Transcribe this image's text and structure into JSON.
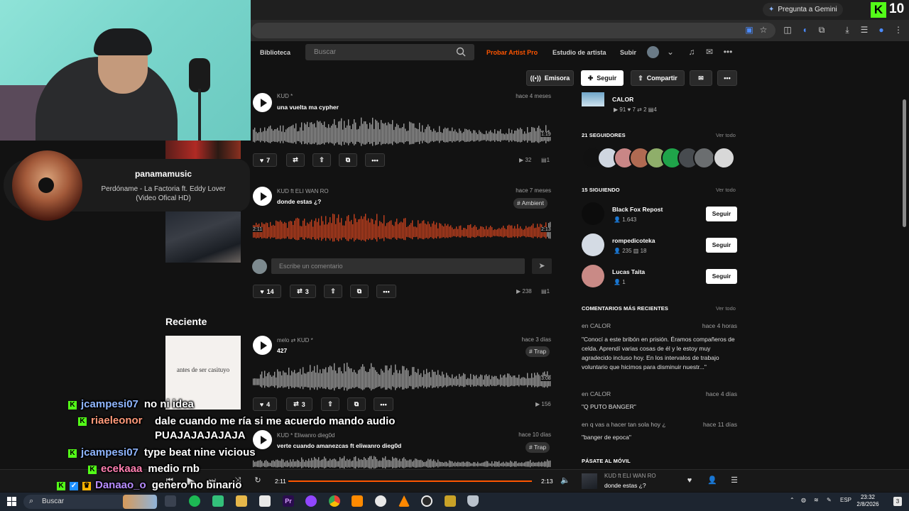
{
  "browser": {
    "gemini_label": "Pregunta a Gemini",
    "kick_counter": "10"
  },
  "header": {
    "library": "Biblioteca",
    "search_placeholder": "Buscar",
    "artist_pro": "Probar Artist Pro",
    "artist_studio": "Estudio de artista",
    "upload": "Subir"
  },
  "profile_actions": {
    "station": "Emisora",
    "follow": "Seguir",
    "share": "Compartir"
  },
  "tracks": [
    {
      "artist": "KUD *",
      "title": "una vuelta ma cypher",
      "date": "hace 4 meses",
      "duration": "1:19",
      "likes": "7",
      "reposts": "",
      "plays": "32",
      "comments": "1"
    },
    {
      "artist": "KUD ft ELI WAN RO",
      "title": "donde estas ¿?",
      "date": "hace 7 meses",
      "tag": "# Ambient",
      "elapsed": "2:11",
      "duration": "2:13",
      "progress": 0.985,
      "likes": "14",
      "reposts": "3",
      "plays": "238",
      "comments": "1"
    }
  ],
  "comment_placeholder": "Escribe un comentario",
  "recent": {
    "heading": "Reciente",
    "cover_text": "antes de ser casituyo",
    "tracks": [
      {
        "artist": "melo",
        "repost_by": "KUD *",
        "title": "427",
        "date": "hace 3 días",
        "tag": "# Trap",
        "duration": "3:08",
        "likes": "4",
        "reposts": "3",
        "plays": "156"
      },
      {
        "artist": "KUD * Eliwanro dieg0d",
        "title": "verte cuando amanezcas ft eliwanro dieg0d",
        "date": "hace 10 días",
        "tag": "# Trap"
      }
    ]
  },
  "sidebar": {
    "top_track": {
      "title": "CALOR",
      "plays": "91",
      "likes": "7",
      "reposts": "2",
      "comments": "4"
    },
    "followers": {
      "heading": "21 SEGUIDORES",
      "view_all": "Ver todo"
    },
    "following": {
      "heading": "15 SIGUIENDO",
      "view_all": "Ver todo",
      "users": [
        {
          "name": "Black Fox Repost",
          "followers": "1.643",
          "tracks": "",
          "follow": "Seguir"
        },
        {
          "name": "rompedicoteka",
          "followers": "235",
          "tracks": "18",
          "follow": "Seguir"
        },
        {
          "name": "Lucas Taita",
          "followers": "1",
          "tracks": "",
          "follow": "Seguir"
        }
      ]
    },
    "comments": {
      "heading": "COMENTARIOS MÁS RECIENTES",
      "view_all": "Ver todo",
      "items": [
        {
          "on": "en CALOR",
          "date": "hace 4 horas",
          "text": "\"Conocí a este bribón en prisión. Éramos compañeros de celda. Aprendí varias cosas de él y le estoy muy agradecido incluso hoy. En los intervalos de trabajo voluntario que hicimos para disminuir nuestr...\""
        },
        {
          "on": "en CALOR",
          "date": "hace 4 días",
          "text": "\"Q PUTO BANGER\""
        },
        {
          "on": "en q vas a hacer tan sola hoy ¿",
          "date": "hace 11 días",
          "text": "\"banger de epoca\""
        }
      ]
    },
    "mobile_heading": "PÁSATE AL MÓVIL"
  },
  "now_playing_overlay": {
    "user": "panamamusic",
    "song": "Perdóname - La Factoria ft. Eddy Lover (Video Ofical HD)"
  },
  "chat": [
    {
      "user": "jcampesi07",
      "message": "no ni idea",
      "color": "#8fb6ff"
    },
    {
      "user": "riaeleonor",
      "message": "dale cuando me ría si me acuerdo mando audio PUAJAJAJAJAJA",
      "color": "#ff9a7a"
    },
    {
      "user": "jcampesi07",
      "message": "type beat nine vicious",
      "color": "#8fb6ff"
    },
    {
      "user": "ecekaaa",
      "message": "medio rnb",
      "color": "#ff7fb0"
    },
    {
      "user": "Danaao_o",
      "message": "genero no binario",
      "color": "#b78cff"
    }
  ],
  "player": {
    "elapsed": "2:11",
    "duration": "2:13",
    "progress": 0.985,
    "artist": "KUD ft ELI WAN RO",
    "title": "donde estas ¿?"
  },
  "taskbar": {
    "search": "Buscar",
    "lang": "ESP",
    "time": "23:32",
    "date": "2/8/2026",
    "notifications": "3"
  },
  "colors": {
    "accent": "#ff5500",
    "kick": "#53fc18",
    "bg": "#121212"
  }
}
